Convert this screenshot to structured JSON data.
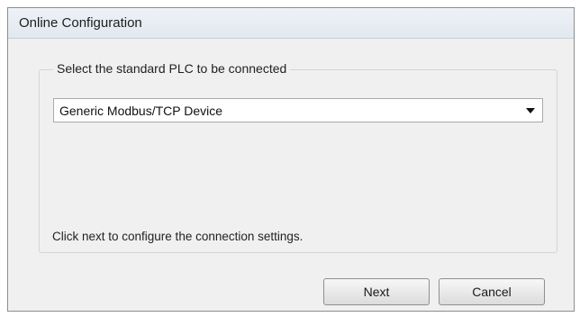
{
  "window": {
    "title": "Online Configuration"
  },
  "group": {
    "label": "Select the standard PLC to be connected"
  },
  "plc_select": {
    "selected": "Generic Modbus/TCP Device"
  },
  "hint": {
    "text": "Click next to configure the connection settings."
  },
  "buttons": {
    "next_label": "Next",
    "cancel_label": "Cancel"
  }
}
